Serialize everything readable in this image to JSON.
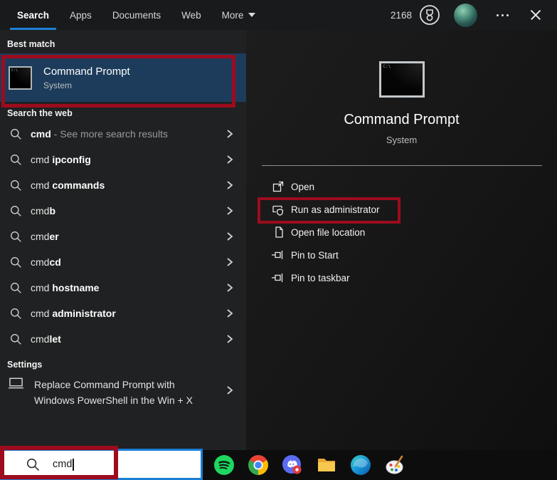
{
  "topbar": {
    "tabs": [
      {
        "label": "Search"
      },
      {
        "label": "Apps"
      },
      {
        "label": "Documents"
      },
      {
        "label": "Web"
      },
      {
        "label": "More"
      }
    ],
    "active_tab": "Search",
    "rewards_points": "2168"
  },
  "left": {
    "best_match_label": "Best match",
    "best_match": {
      "title": "Command Prompt",
      "subtitle": "System"
    },
    "web_label": "Search the web",
    "web_items": [
      {
        "typed": "cmd",
        "completion": "",
        "note": " - See more search results"
      },
      {
        "typed": "cmd ",
        "completion": "ipconfig",
        "note": ""
      },
      {
        "typed": "cmd ",
        "completion": "commands",
        "note": ""
      },
      {
        "typed": "cmd",
        "completion": "b",
        "note": ""
      },
      {
        "typed": "cmd",
        "completion": "er",
        "note": ""
      },
      {
        "typed": "cmd",
        "completion": "cd",
        "note": ""
      },
      {
        "typed": "cmd ",
        "completion": "hostname",
        "note": ""
      },
      {
        "typed": "cmd ",
        "completion": "administrator",
        "note": ""
      },
      {
        "typed": "cmd",
        "completion": "let",
        "note": ""
      }
    ],
    "settings_label": "Settings",
    "settings_item": {
      "line1": "Replace Command Prompt with",
      "line2": "Windows PowerShell in the Win + X"
    }
  },
  "preview": {
    "title": "Command Prompt",
    "subtitle": "System",
    "actions": [
      {
        "label": "Open",
        "icon": "open-window-icon"
      },
      {
        "label": "Run as administrator",
        "icon": "admin-shield-icon"
      },
      {
        "label": "Open file location",
        "icon": "file-location-icon"
      },
      {
        "label": "Pin to Start",
        "icon": "pin-icon"
      },
      {
        "label": "Pin to taskbar",
        "icon": "pin-icon"
      }
    ]
  },
  "search_box": {
    "value": "cmd"
  },
  "cmd_icon_text": "C:\\",
  "taskbar_icons": [
    "spotify-icon",
    "chrome-icon",
    "discord-icon",
    "file-explorer-icon",
    "edge-icon",
    "paint3d-icon"
  ],
  "colors": {
    "accent_blue": "#1f7fd6",
    "highlight_navy": "#1d3c5b",
    "annotation_red": "#9c0c1e",
    "search_border_blue": "#1b7fd4"
  }
}
